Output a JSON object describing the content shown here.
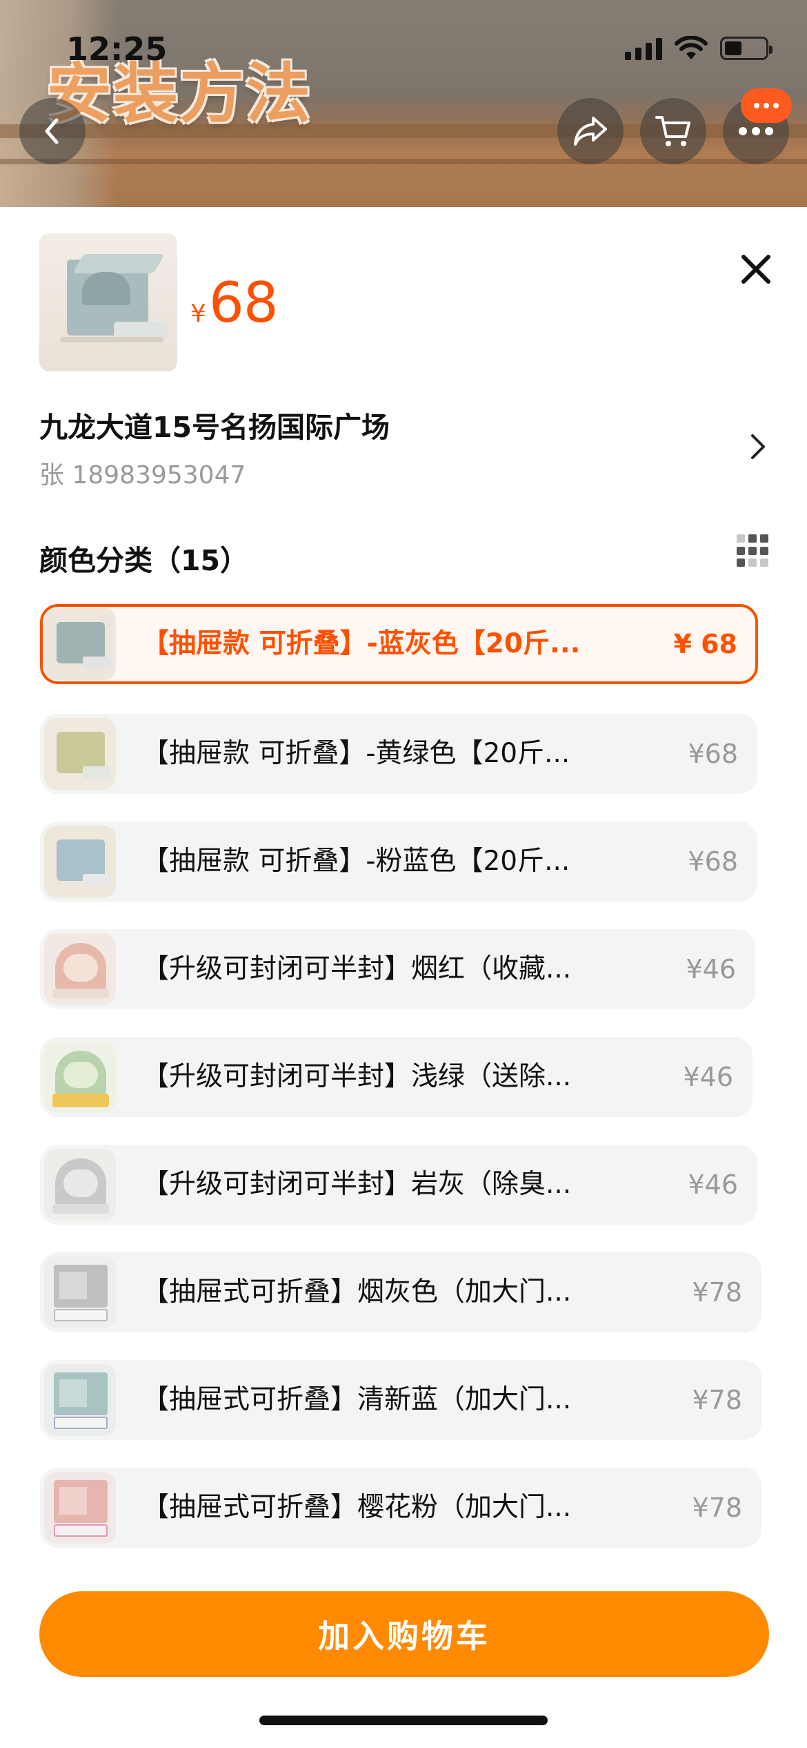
{
  "status_bar": {
    "time": "12:25"
  },
  "video": {
    "caption": "安装方法"
  },
  "product": {
    "currency": "¥",
    "price": "68"
  },
  "address": {
    "line": "九龙大道15号名扬国际广场",
    "contact": "张 18983953047"
  },
  "section": {
    "title": "颜色分类（15）"
  },
  "options": [
    {
      "label": "【抽屉款 可折叠】-蓝灰色【20斤...",
      "price": "¥ 68",
      "selected": true,
      "color": "#9fb3b3"
    },
    {
      "label": "【抽屉款 可折叠】-黄绿色【20斤...",
      "price": "¥68",
      "selected": false,
      "color": "#c9c99a"
    },
    {
      "label": "【抽屉款 可折叠】-粉蓝色【20斤...",
      "price": "¥68",
      "selected": false,
      "color": "#a9c1c8"
    },
    {
      "label": "【升级可封闭可半封】烟红（收藏...",
      "price": "¥46",
      "selected": false,
      "color": "#e7b9ab"
    },
    {
      "label": "【升级可封闭可半封】浅绿（送除...",
      "price": "¥46",
      "selected": false,
      "color": "#b8d3ad"
    },
    {
      "label": "【升级可封闭可半封】岩灰（除臭...",
      "price": "¥46",
      "selected": false,
      "color": "#c9c9c9"
    },
    {
      "label": "【抽屉式可折叠】烟灰色（加大门...",
      "price": "¥78",
      "selected": false,
      "color": "#bfbfbf"
    },
    {
      "label": "【抽屉式可折叠】清新蓝（加大门...",
      "price": "¥78",
      "selected": false,
      "color": "#a8c3c1"
    },
    {
      "label": "【抽屉式可折叠】樱花粉（加大门...",
      "price": "¥78",
      "selected": false,
      "color": "#e6b5ad"
    }
  ],
  "cart_button": {
    "label": "加入购物车"
  },
  "colors": {
    "accent": "#ff5000",
    "cta": "#ff8a00"
  }
}
